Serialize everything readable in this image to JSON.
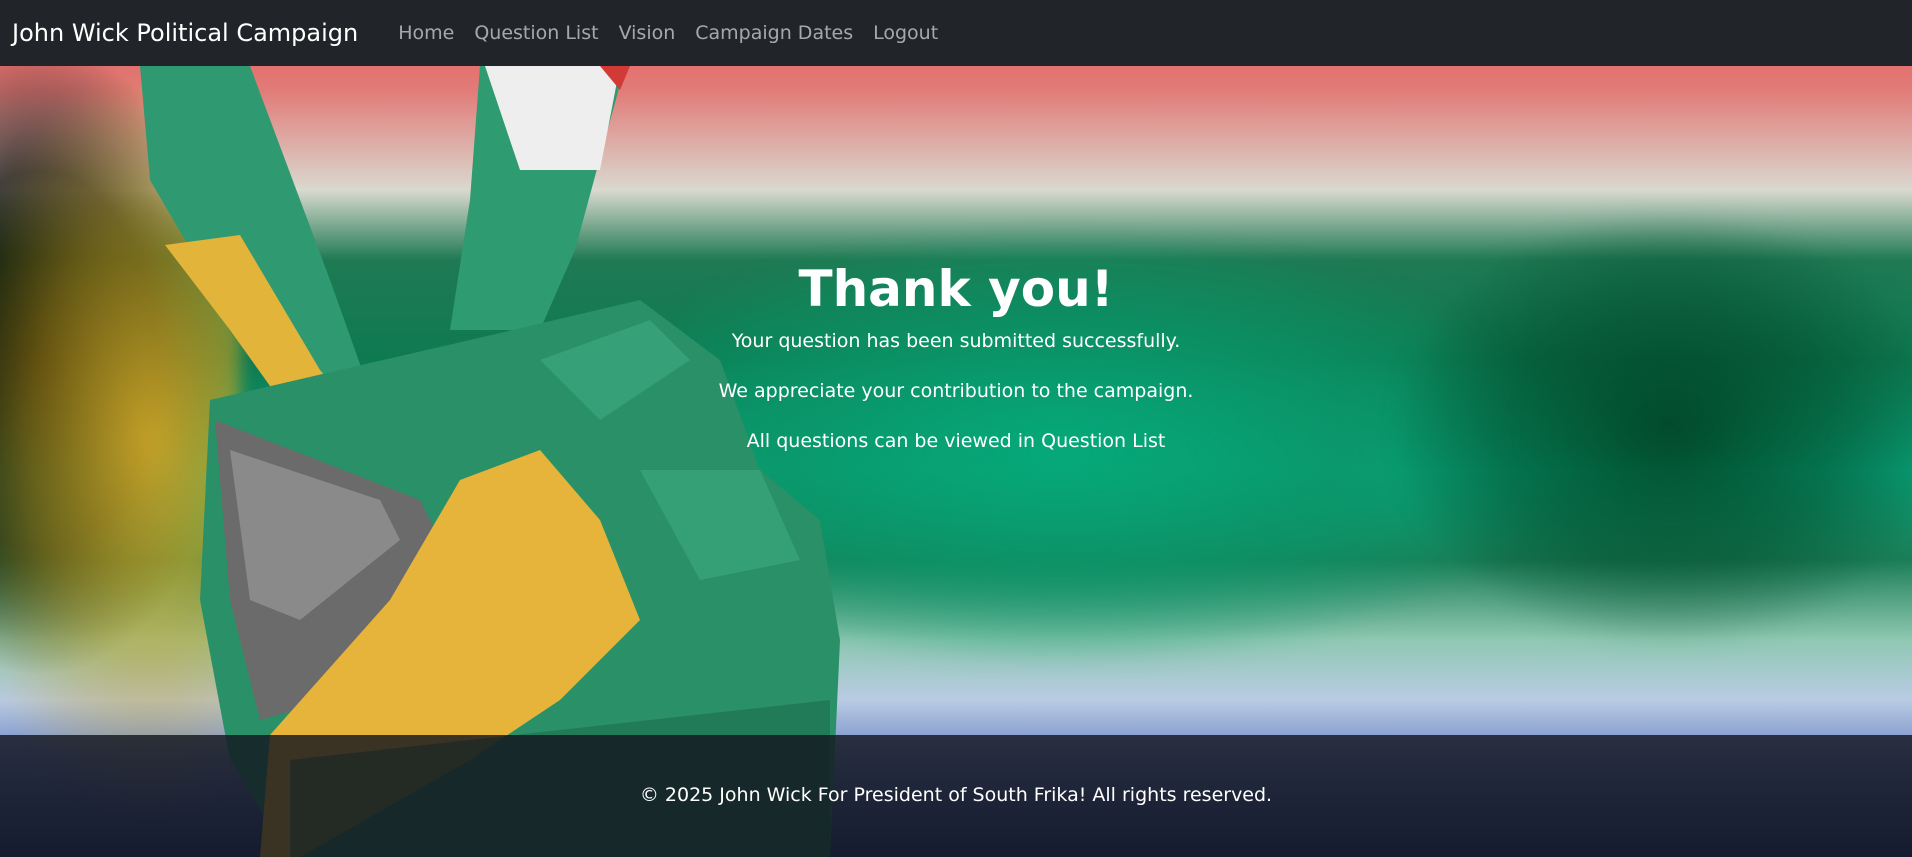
{
  "navbar": {
    "brand": "John Wick Political Campaign",
    "links": [
      {
        "label": "Home"
      },
      {
        "label": "Question List"
      },
      {
        "label": "Vision"
      },
      {
        "label": "Campaign Dates"
      },
      {
        "label": "Logout"
      }
    ]
  },
  "main": {
    "heading": "Thank you!",
    "lines": [
      "Your question has been submitted successfully.",
      "We appreciate your contribution to the campaign.",
      "All questions can be viewed in Question List"
    ]
  },
  "footer": {
    "text": "© 2025 John Wick For President of South Frika! All rights reserved."
  },
  "colors": {
    "navbar_bg": "#212529",
    "nav_link": "rgba(255,255,255,0.6)",
    "text": "#ffffff"
  },
  "background": {
    "description_icon": "south-africa-flag-peace-hand-image"
  }
}
